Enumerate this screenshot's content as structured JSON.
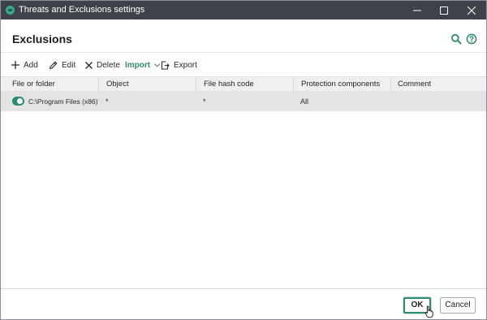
{
  "window": {
    "title": "Threats and Exclusions settings",
    "controls": {
      "minimize": "minimize",
      "maximize": "maximize",
      "close": "close"
    }
  },
  "header": {
    "title": "Exclusions",
    "icons": [
      "search-icon",
      "help-icon"
    ]
  },
  "toolbar": {
    "add_label": "Add",
    "edit_label": "Edit",
    "delete_label": "Delete",
    "import_label": "Import",
    "export_label": "Export"
  },
  "table": {
    "columns": [
      "File or folder",
      "Object",
      "File hash code",
      "Protection components",
      "Comment"
    ],
    "rows": [
      {
        "enabled": true,
        "file_or_folder": "C:\\Program Files (x86)\\",
        "object": "*",
        "file_hash_code": "*",
        "protection_components": "All",
        "comment": ""
      }
    ]
  },
  "footer": {
    "ok_label": "OK",
    "cancel_label": "Cancel"
  },
  "colors": {
    "accent": "#2f8a73",
    "titlebar": "#3d4349",
    "row_selected": "#e4e4e4"
  }
}
